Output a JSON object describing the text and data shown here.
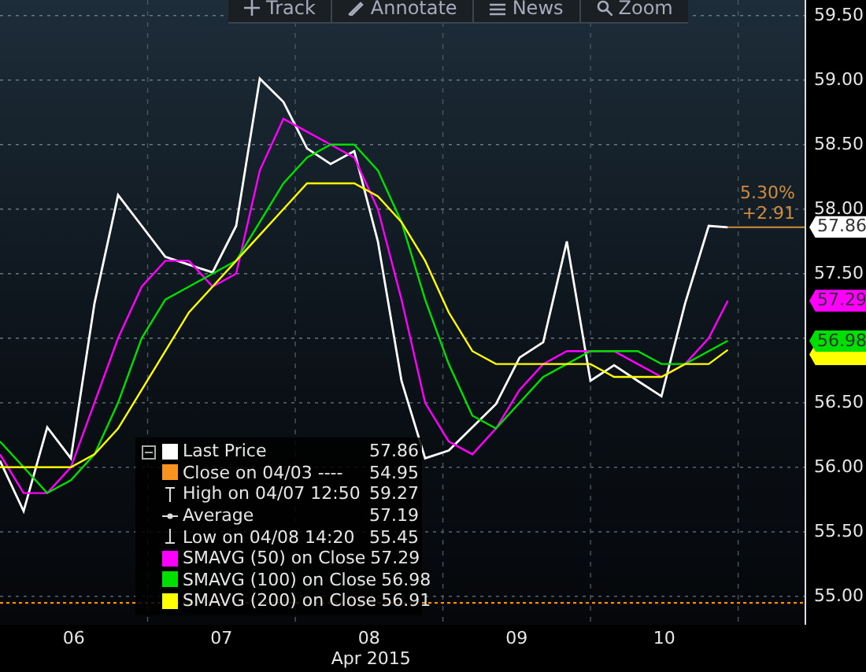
{
  "toolbar": [
    {
      "kind": "track",
      "label": "Track"
    },
    {
      "kind": "annotate",
      "label": "Annotate"
    },
    {
      "kind": "news",
      "label": "News"
    },
    {
      "kind": "zoom",
      "label": "Zoom"
    }
  ],
  "chart": {
    "change_percent": "5.30%",
    "change_value": "+2.91",
    "price_tags": [
      {
        "label": "57.86",
        "color": "#ffffff"
      },
      {
        "label": "57.29",
        "color": "#ff00ff"
      },
      {
        "label": "56.98",
        "color": "#00e000"
      },
      {
        "color": "#ffff00"
      }
    ],
    "chart_data": {
      "type": "line",
      "xlabel": "Apr 2015",
      "xlim": [
        5.5,
        10.95
      ],
      "ylim": [
        54.78,
        59.62
      ],
      "grid": true,
      "legend": "lower left",
      "x": [
        5.5,
        5.66,
        5.82,
        5.98,
        6.14,
        6.3,
        6.46,
        6.62,
        6.78,
        6.94,
        7.1,
        7.26,
        7.42,
        7.58,
        7.74,
        7.9,
        8.06,
        8.22,
        8.38,
        8.54,
        8.7,
        8.86,
        9.02,
        9.18,
        9.34,
        9.5,
        9.66,
        9.82,
        9.98,
        10.14,
        10.3,
        10.43
      ],
      "xticks": [
        {
          "value": 6,
          "label": "06"
        },
        {
          "value": 7,
          "label": "07"
        },
        {
          "value": 8,
          "label": "08"
        },
        {
          "value": 9,
          "label": "09"
        },
        {
          "value": 10,
          "label": "10"
        }
      ],
      "yticks": [
        {
          "value": 55,
          "label": "55.00"
        },
        {
          "value": 55.5,
          "label": "55.50"
        },
        {
          "value": 56,
          "label": "56.00"
        },
        {
          "value": 56.5,
          "label": "56.50"
        },
        {
          "value": 57.5,
          "label": "57.50"
        },
        {
          "value": 58,
          "label": "58.00"
        },
        {
          "value": 58.5,
          "label": "58.50"
        },
        {
          "value": 59,
          "label": "59.00"
        },
        {
          "value": 59.5,
          "label": "59.50"
        }
      ],
      "series": [
        {
          "name": "Last Price",
          "color": "#ffffff",
          "values": [
            56.05,
            55.66,
            56.31,
            56.07,
            57.27,
            58.11,
            57.87,
            57.63,
            57.57,
            57.51,
            57.87,
            59.01,
            58.83,
            58.47,
            58.35,
            58.45,
            57.75,
            56.67,
            56.07,
            56.13,
            56.31,
            56.49,
            56.85,
            56.97,
            57.75,
            56.67,
            56.79,
            56.67,
            56.55,
            57.27,
            57.87,
            57.86
          ]
        },
        {
          "name": "SMAVG (50) on Close",
          "color": "#ff00ff",
          "values": [
            56.1,
            55.8,
            55.8,
            56.0,
            56.5,
            57.0,
            57.4,
            57.6,
            57.6,
            57.4,
            57.5,
            58.3,
            58.7,
            58.6,
            58.5,
            58.4,
            58.0,
            57.3,
            56.5,
            56.2,
            56.1,
            56.3,
            56.6,
            56.8,
            56.9,
            56.9,
            56.9,
            56.8,
            56.7,
            56.8,
            57.0,
            57.29
          ]
        },
        {
          "name": "SMAVG (100) on Close",
          "color": "#00e000",
          "values": [
            56.2,
            56.0,
            55.8,
            55.9,
            56.1,
            56.5,
            57.0,
            57.3,
            57.4,
            57.5,
            57.6,
            57.9,
            58.2,
            58.4,
            58.5,
            58.5,
            58.3,
            57.9,
            57.3,
            56.8,
            56.4,
            56.3,
            56.5,
            56.7,
            56.8,
            56.9,
            56.9,
            56.9,
            56.8,
            56.8,
            56.9,
            56.98
          ]
        },
        {
          "name": "SMAVG (200) on Close",
          "color": "#ffff00",
          "values": [
            56.0,
            56.0,
            56.0,
            56.0,
            56.1,
            56.3,
            56.6,
            56.9,
            57.2,
            57.4,
            57.6,
            57.8,
            58.0,
            58.2,
            58.2,
            58.2,
            58.1,
            57.9,
            57.6,
            57.2,
            56.9,
            56.8,
            56.8,
            56.8,
            56.8,
            56.8,
            56.7,
            56.7,
            56.7,
            56.8,
            56.8,
            56.91
          ]
        }
      ],
      "ref_lines": [
        {
          "axis": "y",
          "value": 54.95
        }
      ]
    }
  },
  "legend": {
    "series_values": [
      "57.86",
      "57.29",
      "56.98",
      "56.91"
    ],
    "items": [
      {
        "kind": "swatch",
        "label": "Close on 04/03 ----",
        "value": "54.95",
        "color": "#f7931e"
      },
      {
        "kind": "high",
        "label": "High on 04/07 12:50",
        "value": "59.27"
      },
      {
        "kind": "average",
        "label": "Average",
        "value": "57.19"
      },
      {
        "kind": "low",
        "label": "Low on 04/08 14:20",
        "value": "55.45"
      }
    ]
  }
}
